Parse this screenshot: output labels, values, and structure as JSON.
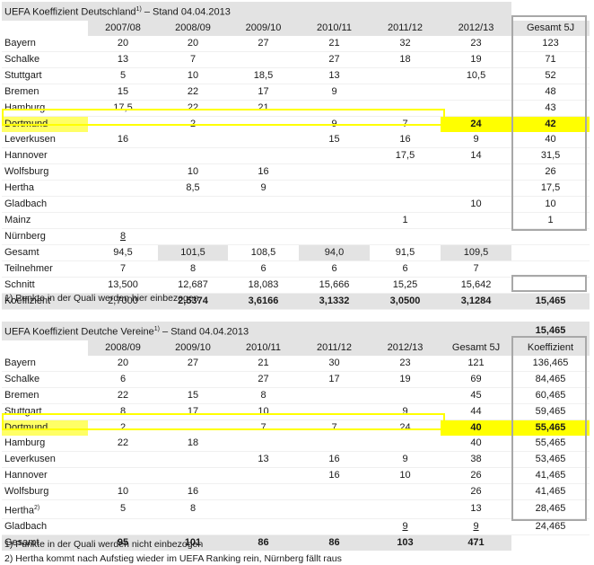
{
  "table1": {
    "title": "UEFA Koeffizient Deutschland",
    "title_sup": "1)",
    "title_suffix": " – Stand 04.04.2013",
    "headers": [
      "2007/08",
      "2008/09",
      "2009/10",
      "2010/11",
      "2011/12",
      "2012/13",
      "Gesamt 5J"
    ],
    "rows": [
      {
        "club": "Bayern",
        "v": [
          "20",
          "20",
          "27",
          "21",
          "32",
          "23",
          "123"
        ]
      },
      {
        "club": "Schalke",
        "v": [
          "13",
          "7",
          "",
          "27",
          "18",
          "19",
          "71"
        ]
      },
      {
        "club": "Stuttgart",
        "v": [
          "5",
          "10",
          "18,5",
          "13",
          "",
          "10,5",
          "52"
        ]
      },
      {
        "club": "Bremen",
        "v": [
          "15",
          "22",
          "17",
          "9",
          "",
          "",
          "48"
        ]
      },
      {
        "club": "Hamburg",
        "v": [
          "17,5",
          "22",
          "21",
          "",
          "",
          "",
          "43"
        ]
      },
      {
        "club": "Dortmund",
        "v": [
          "",
          "2",
          "",
          "9",
          "7",
          "24",
          "42"
        ]
      },
      {
        "club": "Leverkusen",
        "v": [
          "16",
          "",
          "",
          "15",
          "16",
          "9",
          "40"
        ]
      },
      {
        "club": "Hannover",
        "v": [
          "",
          "",
          "",
          "",
          "17,5",
          "14",
          "31,5"
        ]
      },
      {
        "club": "Wolfsburg",
        "v": [
          "",
          "10",
          "16",
          "",
          "",
          "",
          "26"
        ]
      },
      {
        "club": "Hertha",
        "v": [
          "",
          "8,5",
          "9",
          "",
          "",
          "",
          "17,5"
        ]
      },
      {
        "club": "Gladbach",
        "v": [
          "",
          "",
          "",
          "",
          "",
          "10",
          "10"
        ]
      },
      {
        "club": "Mainz",
        "v": [
          "",
          "",
          "",
          "",
          "1",
          "",
          "1"
        ]
      },
      {
        "club": "Nürnberg",
        "v": [
          "8",
          "",
          "",
          "",
          "",
          "",
          ""
        ]
      }
    ],
    "summary": [
      {
        "label": "Gesamt",
        "v": [
          "94,5",
          "101,5",
          "108,5",
          "94,0",
          "91,5",
          "109,5",
          ""
        ]
      },
      {
        "label": "Teilnehmer",
        "v": [
          "7",
          "8",
          "6",
          "6",
          "6",
          "7",
          ""
        ]
      },
      {
        "label": "Schnitt",
        "v": [
          "13,500",
          "12,687",
          "18,083",
          "15,666",
          "15,25",
          "15,642",
          ""
        ]
      },
      {
        "label": "Koeffizient",
        "v": [
          "2,7000",
          "2,5374",
          "3,6166",
          "3,1332",
          "3,0500",
          "3,1284",
          "15,465"
        ]
      }
    ],
    "footnote": "1)  Punkte in der Quali werden hier einbezogen"
  },
  "table2": {
    "title": "UEFA Koeffizient Deutche Vereine",
    "title_sup": "1)",
    "title_suffix": " – Stand 04.04.2013",
    "top_value": "15,465",
    "headers": [
      "2008/09",
      "2009/10",
      "2010/11",
      "2011/12",
      "2012/13",
      "Gesamt 5J",
      "Koeffizient"
    ],
    "rows": [
      {
        "club": "Bayern",
        "sup": "",
        "v": [
          "20",
          "27",
          "21",
          "30",
          "23",
          "121",
          "136,465"
        ]
      },
      {
        "club": "Schalke",
        "sup": "",
        "v": [
          "6",
          "",
          "27",
          "17",
          "19",
          "69",
          "84,465"
        ]
      },
      {
        "club": "Bremen",
        "sup": "",
        "v": [
          "22",
          "15",
          "8",
          "",
          "",
          "45",
          "60,465"
        ]
      },
      {
        "club": "Stuttgart",
        "sup": "",
        "v": [
          "8",
          "17",
          "10",
          "",
          "9",
          "44",
          "59,465"
        ]
      },
      {
        "club": "Dortmund",
        "sup": "",
        "v": [
          "2",
          "",
          "7",
          "7",
          "24",
          "40",
          "55,465"
        ]
      },
      {
        "club": "Hamburg",
        "sup": "",
        "v": [
          "22",
          "18",
          "",
          "",
          "",
          "40",
          "55,465"
        ]
      },
      {
        "club": "Leverkusen",
        "sup": "",
        "v": [
          "",
          "",
          "13",
          "16",
          "9",
          "38",
          "53,465"
        ]
      },
      {
        "club": "Hannover",
        "sup": "",
        "v": [
          "",
          "",
          "",
          "16",
          "10",
          "26",
          "41,465"
        ]
      },
      {
        "club": "Wolfsburg",
        "sup": "",
        "v": [
          "10",
          "16",
          "",
          "",
          "",
          "26",
          "41,465"
        ]
      },
      {
        "club": "Hertha",
        "sup": "2)",
        "v": [
          "5",
          "8",
          "",
          "",
          "",
          "13",
          "28,465"
        ]
      },
      {
        "club": "Gladbach",
        "sup": "",
        "v": [
          "",
          "",
          "",
          "",
          "9",
          "9",
          "24,465"
        ]
      }
    ],
    "summary": {
      "label": "Gesamt",
      "v": [
        "95",
        "101",
        "86",
        "86",
        "103",
        "471",
        ""
      ]
    },
    "footnotes": [
      "1)  Punkte in der Quali werden nicht einbezogen",
      "2)  Hertha kommt nach Aufstieg wieder im UEFA Ranking rein, Nürnberg fällt raus"
    ]
  }
}
